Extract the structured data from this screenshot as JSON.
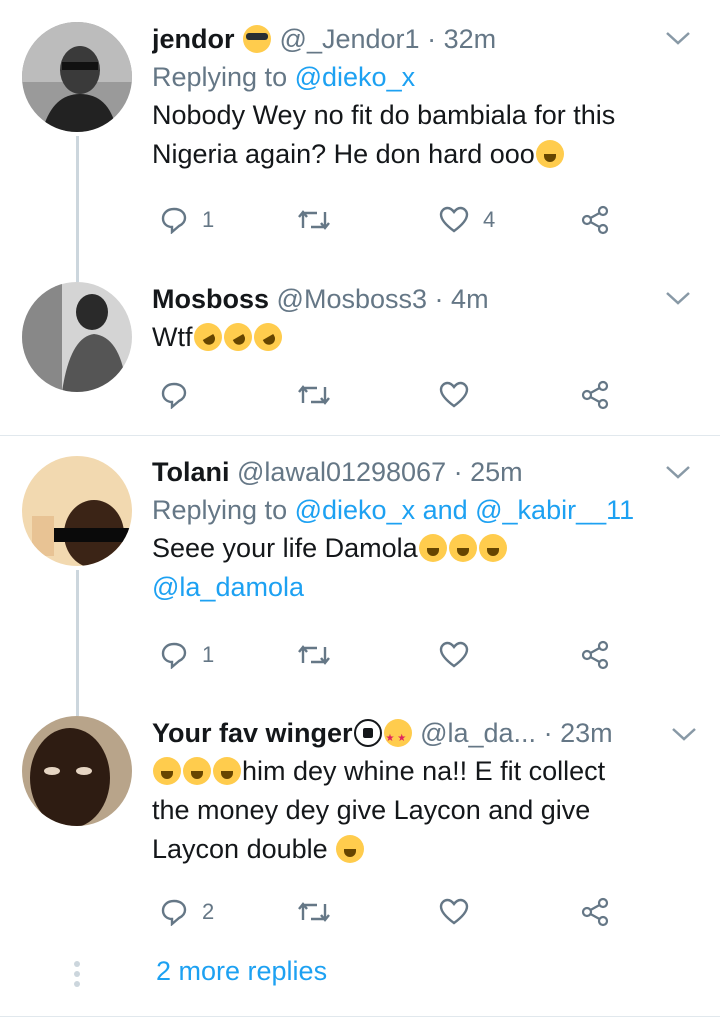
{
  "tweets": [
    {
      "name": "jendor",
      "handle": "@_Jendor1",
      "time": "32m",
      "replying_prefix": "Replying to",
      "replying_to": "@dieko_x",
      "text_line1": "Nobody Wey no fit do bambiala for this",
      "text_line2": "Nigeria  again? He don hard ooo",
      "reply_count": "1",
      "like_count": "4"
    },
    {
      "name": "Mosboss",
      "handle": "@Mosboss3",
      "time": "4m",
      "text": "Wtf"
    },
    {
      "name": "Tolani",
      "handle": "@lawal01298067",
      "time": "25m",
      "replying_prefix": "Replying to",
      "replying_to": "@dieko_x and @_kabir__11",
      "text_line1": "Seee your life Damola",
      "mention": "@la_damola",
      "reply_count": "1"
    },
    {
      "name": "Your fav winger",
      "handle": "@la_da...",
      "time": "23m",
      "text_line1": "him dey whine na!! E fit collect",
      "text_line2": "the money dey give Laycon and give",
      "text_line3": "Laycon double",
      "reply_count": "2"
    }
  ],
  "more_replies": "2 more replies",
  "icons": [
    "reply-icon",
    "retweet-icon",
    "like-icon",
    "share-icon",
    "chevron-down-icon"
  ],
  "colors": {
    "accent": "#1da1f2",
    "secondary": "#657786",
    "divider": "#e1e8ed"
  }
}
